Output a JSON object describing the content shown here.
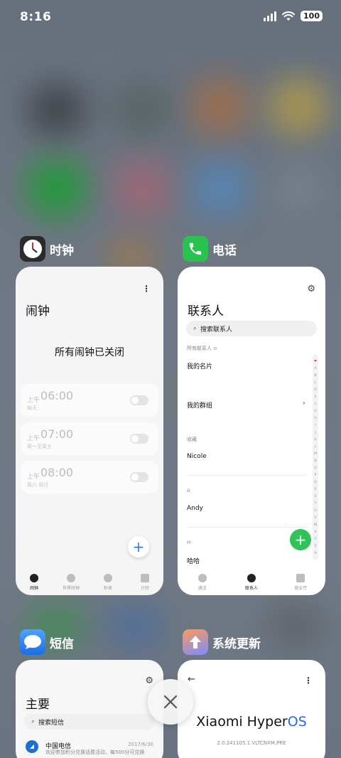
{
  "status_bar": {
    "time": "8:16",
    "battery": "100"
  },
  "apps": {
    "clock": {
      "name": "时钟",
      "screen_title": "闹钟",
      "empty_message": "所有闹钟已关闭",
      "alarms": [
        {
          "period": "上午",
          "time": "06:00",
          "repeat": "每天"
        },
        {
          "period": "上午",
          "time": "07:00",
          "repeat": "周一至周五"
        },
        {
          "period": "上午",
          "time": "08:00",
          "repeat": "周六 周日"
        }
      ],
      "tabs": [
        {
          "label": "闹钟",
          "icon": "alarm-icon"
        },
        {
          "label": "世界时钟",
          "icon": "world-clock-icon"
        },
        {
          "label": "秒表",
          "icon": "stopwatch-icon"
        },
        {
          "label": "计时",
          "icon": "timer-icon"
        }
      ]
    },
    "phone": {
      "name": "电话",
      "screen_title": "联系人",
      "search_placeholder": "搜索联系人",
      "filter_label": "所有联系人 ≎",
      "my_card": "我的名片",
      "my_groups": "我的群组",
      "favorites_header": "收藏",
      "favorite_contact": "Nicole",
      "section_a": "A",
      "contact_a": "Andy",
      "section_h": "H",
      "contact_h": "哈哈",
      "index_letters": [
        "❤",
        "A",
        "B",
        "C",
        "D",
        "E",
        "F",
        "G",
        "H",
        "I",
        "J",
        "K",
        "L",
        "M",
        "N",
        "O",
        "P",
        "Q",
        "R",
        "S",
        "T",
        "U",
        "V",
        "W",
        "X",
        "Y",
        "Z",
        "#"
      ],
      "tabs": [
        {
          "label": "通话",
          "icon": "call-icon"
        },
        {
          "label": "联系人",
          "icon": "contacts-icon"
        },
        {
          "label": "营业厅",
          "icon": "store-icon"
        }
      ]
    },
    "sms": {
      "name": "短信",
      "screen_title": "主要",
      "search_placeholder": "搜索短信",
      "message": {
        "sender": "中国电信",
        "date": "2017/6/30",
        "preview": "欢迎参加积分兑换话费活动，每500分可兑换"
      }
    },
    "update": {
      "name": "系统更新",
      "brand_prefix": "Xiaomi Hyper",
      "brand_suffix": "OS",
      "version": "2.0.241105.1.VLTCNXM.PRE"
    }
  },
  "colors": {
    "accent_blue": "#2a7ff3",
    "fab_green": "#2ec45a",
    "hyperos_blue": "#2a68ea"
  }
}
